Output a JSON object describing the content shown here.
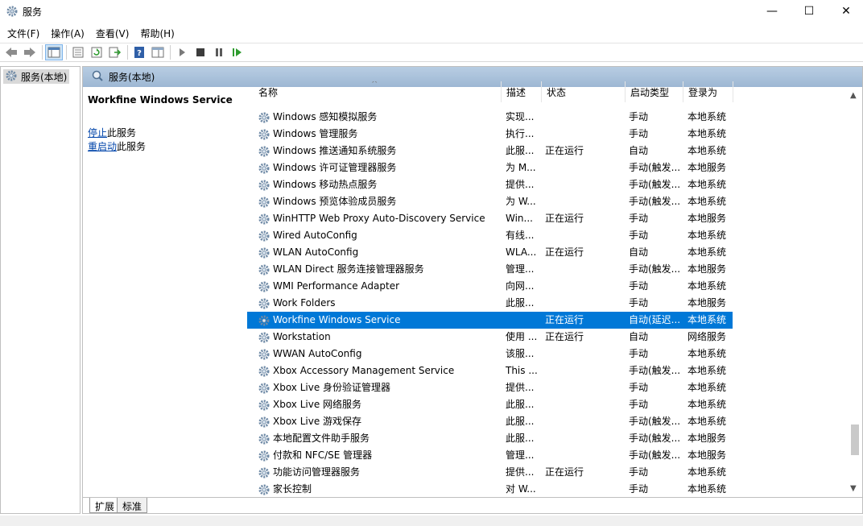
{
  "window": {
    "title": "服务",
    "minimize_glyph": "—",
    "maximize_glyph": "☐",
    "close_glyph": "✕"
  },
  "menu": [
    "文件(F)",
    "操作(A)",
    "查看(V)",
    "帮助(H)"
  ],
  "toolbar": {
    "icons": [
      "back-arrow-icon",
      "forward-arrow-icon",
      "show-hide-tree-icon",
      "properties-icon",
      "refresh-icon",
      "export-list-icon",
      "help-icon",
      "show-pane-icon",
      "start-service-icon",
      "stop-service-icon",
      "pause-service-icon",
      "restart-service-icon"
    ]
  },
  "tree": {
    "item_label": "服务(本地)"
  },
  "content": {
    "header_label": "服务(本地)",
    "selected_service_name": "Workfine Windows Service",
    "action_stop_link": "停止",
    "action_stop_suffix": "此服务",
    "action_restart_link": "重启动",
    "action_restart_suffix": "此服务"
  },
  "columns": {
    "name": "名称",
    "desc": "描述",
    "status": "状态",
    "startup": "启动类型",
    "logon": "登录为"
  },
  "services": [
    {
      "name": "Windows 感知模拟服务",
      "desc": "实现...",
      "status": "",
      "startup": "手动",
      "logon": "本地系统"
    },
    {
      "name": "Windows 管理服务",
      "desc": "执行...",
      "status": "",
      "startup": "手动",
      "logon": "本地系统"
    },
    {
      "name": "Windows 推送通知系统服务",
      "desc": "此服...",
      "status": "正在运行",
      "startup": "自动",
      "logon": "本地系统"
    },
    {
      "name": "Windows 许可证管理器服务",
      "desc": "为 M...",
      "status": "",
      "startup": "手动(触发...",
      "logon": "本地服务"
    },
    {
      "name": "Windows 移动热点服务",
      "desc": "提供...",
      "status": "",
      "startup": "手动(触发...",
      "logon": "本地系统"
    },
    {
      "name": "Windows 预览体验成员服务",
      "desc": "为 W...",
      "status": "",
      "startup": "手动(触发...",
      "logon": "本地系统"
    },
    {
      "name": "WinHTTP Web Proxy Auto-Discovery Service",
      "desc": "Win...",
      "status": "正在运行",
      "startup": "手动",
      "logon": "本地服务"
    },
    {
      "name": "Wired AutoConfig",
      "desc": "有线...",
      "status": "",
      "startup": "手动",
      "logon": "本地系统"
    },
    {
      "name": "WLAN AutoConfig",
      "desc": "WLA...",
      "status": "正在运行",
      "startup": "自动",
      "logon": "本地系统"
    },
    {
      "name": "WLAN Direct 服务连接管理器服务",
      "desc": "管理...",
      "status": "",
      "startup": "手动(触发...",
      "logon": "本地服务"
    },
    {
      "name": "WMI Performance Adapter",
      "desc": "向网...",
      "status": "",
      "startup": "手动",
      "logon": "本地系统"
    },
    {
      "name": "Work Folders",
      "desc": "此服...",
      "status": "",
      "startup": "手动",
      "logon": "本地服务"
    },
    {
      "name": "Workfine Windows Service",
      "desc": "",
      "status": "正在运行",
      "startup": "自动(延迟...",
      "logon": "本地系统",
      "selected": true
    },
    {
      "name": "Workstation",
      "desc": "使用 ...",
      "status": "正在运行",
      "startup": "自动",
      "logon": "网络服务"
    },
    {
      "name": "WWAN AutoConfig",
      "desc": "该服...",
      "status": "",
      "startup": "手动",
      "logon": "本地系统"
    },
    {
      "name": "Xbox Accessory Management Service",
      "desc": "This ...",
      "status": "",
      "startup": "手动(触发...",
      "logon": "本地系统"
    },
    {
      "name": "Xbox Live 身份验证管理器",
      "desc": "提供...",
      "status": "",
      "startup": "手动",
      "logon": "本地系统"
    },
    {
      "name": "Xbox Live 网络服务",
      "desc": "此服...",
      "status": "",
      "startup": "手动",
      "logon": "本地系统"
    },
    {
      "name": "Xbox Live 游戏保存",
      "desc": "此服...",
      "status": "",
      "startup": "手动(触发...",
      "logon": "本地系统"
    },
    {
      "name": "本地配置文件助手服务",
      "desc": "此服...",
      "status": "",
      "startup": "手动(触发...",
      "logon": "本地服务"
    },
    {
      "name": "付款和 NFC/SE 管理器",
      "desc": "管理...",
      "status": "",
      "startup": "手动(触发...",
      "logon": "本地服务"
    },
    {
      "name": "功能访问管理器服务",
      "desc": "提供...",
      "status": "正在运行",
      "startup": "手动",
      "logon": "本地系统"
    },
    {
      "name": "家长控制",
      "desc": "对 W...",
      "status": "",
      "startup": "手动",
      "logon": "本地系统"
    }
  ],
  "tabs": [
    "扩展",
    "标准"
  ],
  "colors": {
    "selection": "#0078d7",
    "header_gradient_top": "#b8cde3",
    "header_gradient_bottom": "#9db7d3"
  }
}
